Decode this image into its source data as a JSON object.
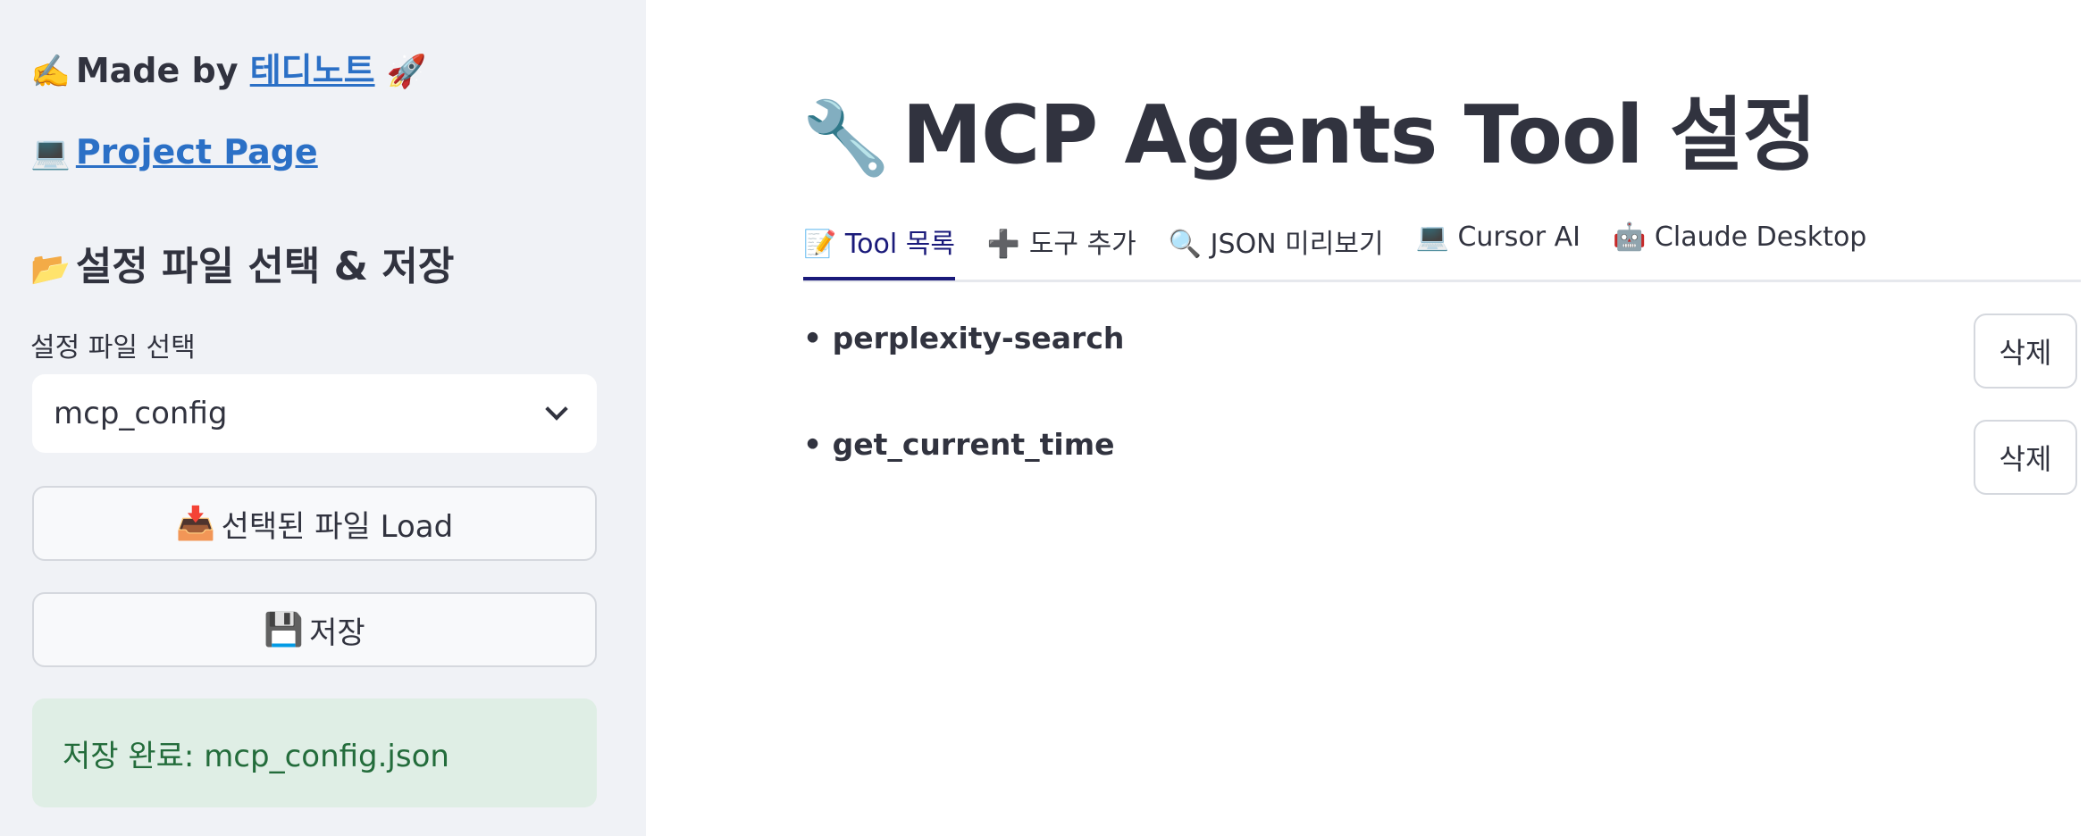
{
  "sidebar": {
    "credit": {
      "icon": "✍️",
      "prefix": "Made by",
      "link": "테디노트",
      "suffix_icon": "🚀"
    },
    "project": {
      "icon": "💻",
      "link": "Project Page"
    },
    "heading": {
      "icon": "📂",
      "text": "설정 파일 선택 & 저장"
    },
    "select_label": "설정 파일 선택",
    "select_value": "mcp_config",
    "load_button": {
      "icon": "📥",
      "label": "선택된 파일 Load"
    },
    "save_button": {
      "icon": "💾",
      "label": "저장"
    },
    "status": "저장 완료: mcp_config.json",
    "status_color": "#236c3b"
  },
  "main": {
    "title": {
      "icon": "🔧",
      "text": "MCP Agents Tool 설정"
    },
    "tabs": [
      {
        "icon": "📝",
        "label": "Tool 목록",
        "active": true
      },
      {
        "icon": "➕",
        "label": "도구 추가"
      },
      {
        "icon": "🔍",
        "label": "JSON 미리보기"
      },
      {
        "icon": "💻",
        "label": "Cursor AI"
      },
      {
        "icon": "🤖",
        "label": "Claude Desktop"
      }
    ],
    "tools": [
      {
        "name": "• perplexity-search",
        "delete_label": "삭제"
      },
      {
        "name": "• get_current_time",
        "delete_label": "삭제"
      }
    ],
    "accent_color": "#1a1a7a"
  }
}
